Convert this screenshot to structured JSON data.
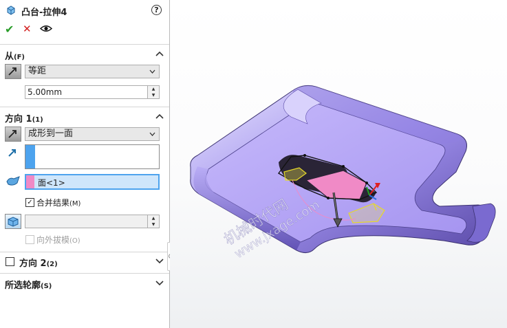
{
  "header": {
    "title": "凸台-拉伸4",
    "help": "?"
  },
  "actions": {
    "ok": "✔",
    "cancel": "✕"
  },
  "from": {
    "title": "从",
    "key": "(F)",
    "condition": "等距",
    "offset": "5.00mm"
  },
  "direction1": {
    "title": "方向 1",
    "key": "(1)",
    "end_condition": "成形到一面",
    "face": "面<1>",
    "merge_label": "合并结果",
    "merge_key": "(M)",
    "merge_checked": true,
    "draft_label": "向外拔模",
    "draft_key": "(O)"
  },
  "direction2": {
    "title": "方向 2",
    "key": "(2)"
  },
  "selected_contours": {
    "title": "所选轮廓",
    "key": "(S)"
  },
  "watermark": {
    "line1": "机械时代网",
    "line2": "www.jxage.com"
  },
  "colors": {
    "part": "#a99af0",
    "highlight_pink": "#f08ac6",
    "selection_blue": "#4da3ee",
    "preview_yellow": "#f2e84a",
    "check_green": "#2a9d2a",
    "cancel_red": "#d32020"
  }
}
